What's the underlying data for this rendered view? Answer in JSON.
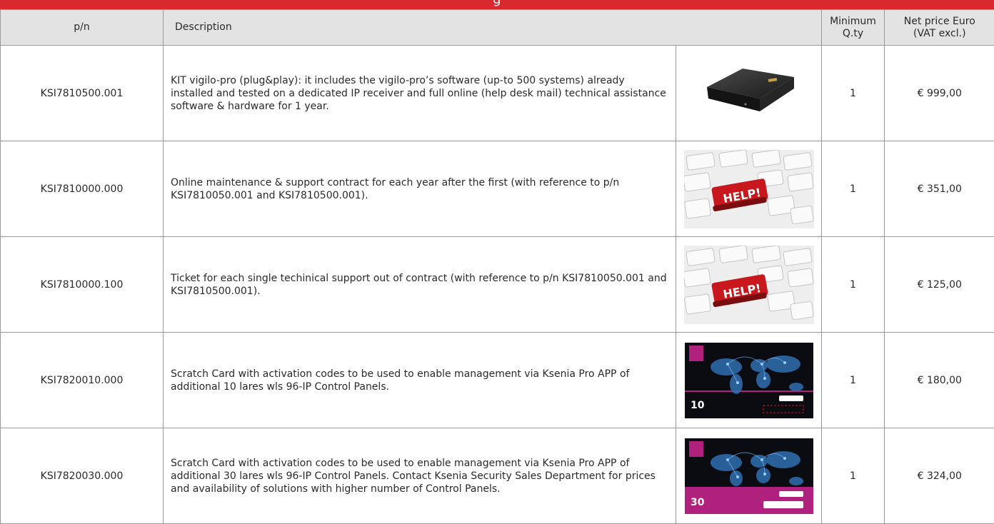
{
  "header": {
    "title": "g"
  },
  "table": {
    "columns": {
      "pn": "p/n",
      "description": "Description",
      "min_qty_line1": "Minimum",
      "min_qty_line2": "Q.ty",
      "price_line1": "Net price Euro",
      "price_line2": "(VAT excl.)"
    },
    "rows": [
      {
        "pn": "KSI7810500.001",
        "description": "KIT vigilo-pro (plug&play): it includes the vigilo-pro’s software (up-to 500 systems) already installed and tested on a dedicated IP receiver and full online (help desk mail) technical assistance software & hardware for 1 year.",
        "image": "black-ip-receiver-box",
        "qty": "1",
        "price": "€ 999,00"
      },
      {
        "pn": "KSI7810000.000",
        "description": "Online maintenance & support contract for each year after the first (with reference to p/n KSI7810050.001 and KSI7810500.001).",
        "image": "keyboard-help-key",
        "qty": "1",
        "price": "€ 351,00"
      },
      {
        "pn": "KSI7810000.100",
        "description": "Ticket for each single techinical support out of contract (with reference to p/n KSI7810050.001 and KSI7810500.001).",
        "image": "keyboard-help-key",
        "qty": "1",
        "price": "€ 125,00"
      },
      {
        "pn": "KSI7820010.000",
        "description": "Scratch Card with activation codes to be used to enable management via Ksenia Pro APP of additional 10 lares wls 96-IP Control Panels.",
        "image": "scratch-card-10",
        "card_number": "10",
        "qty": "1",
        "price": "€ 180,00"
      },
      {
        "pn": "KSI7820030.000",
        "description": "Scratch Card with activation codes to be used to enable management via Ksenia Pro APP of additional 30 lares wls 96-IP Control Panels. Contact Ksenia Security Sales Department for prices and availability of solutions with higher number of Control Panels.",
        "image": "scratch-card-30",
        "card_number": "30",
        "qty": "1",
        "price": "€ 324,00"
      }
    ]
  },
  "colors": {
    "brand_red": "#d8292f",
    "header_gray": "#e3e3e3",
    "card_magenta": "#b0207d"
  }
}
